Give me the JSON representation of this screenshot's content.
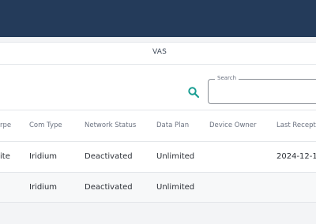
{
  "tabs": [
    {
      "label": "VAS",
      "active": true
    }
  ],
  "search": {
    "label": "Search",
    "value": "",
    "placeholder": ""
  },
  "table": {
    "columns": [
      "rpe",
      "Com Type",
      "Network Status",
      "Data Plan",
      "Device Owner",
      "Last Recept"
    ],
    "rows": [
      [
        "ite",
        "Iridium",
        "Deactivated",
        "Unlimited",
        "",
        "2024-12-1"
      ],
      [
        "",
        "Iridium",
        "Deactivated",
        "Unlimited",
        "",
        ""
      ]
    ]
  },
  "colors": {
    "topbar": "#243b5a",
    "accent": "#1a9e93",
    "border": "#e3e6ea"
  }
}
